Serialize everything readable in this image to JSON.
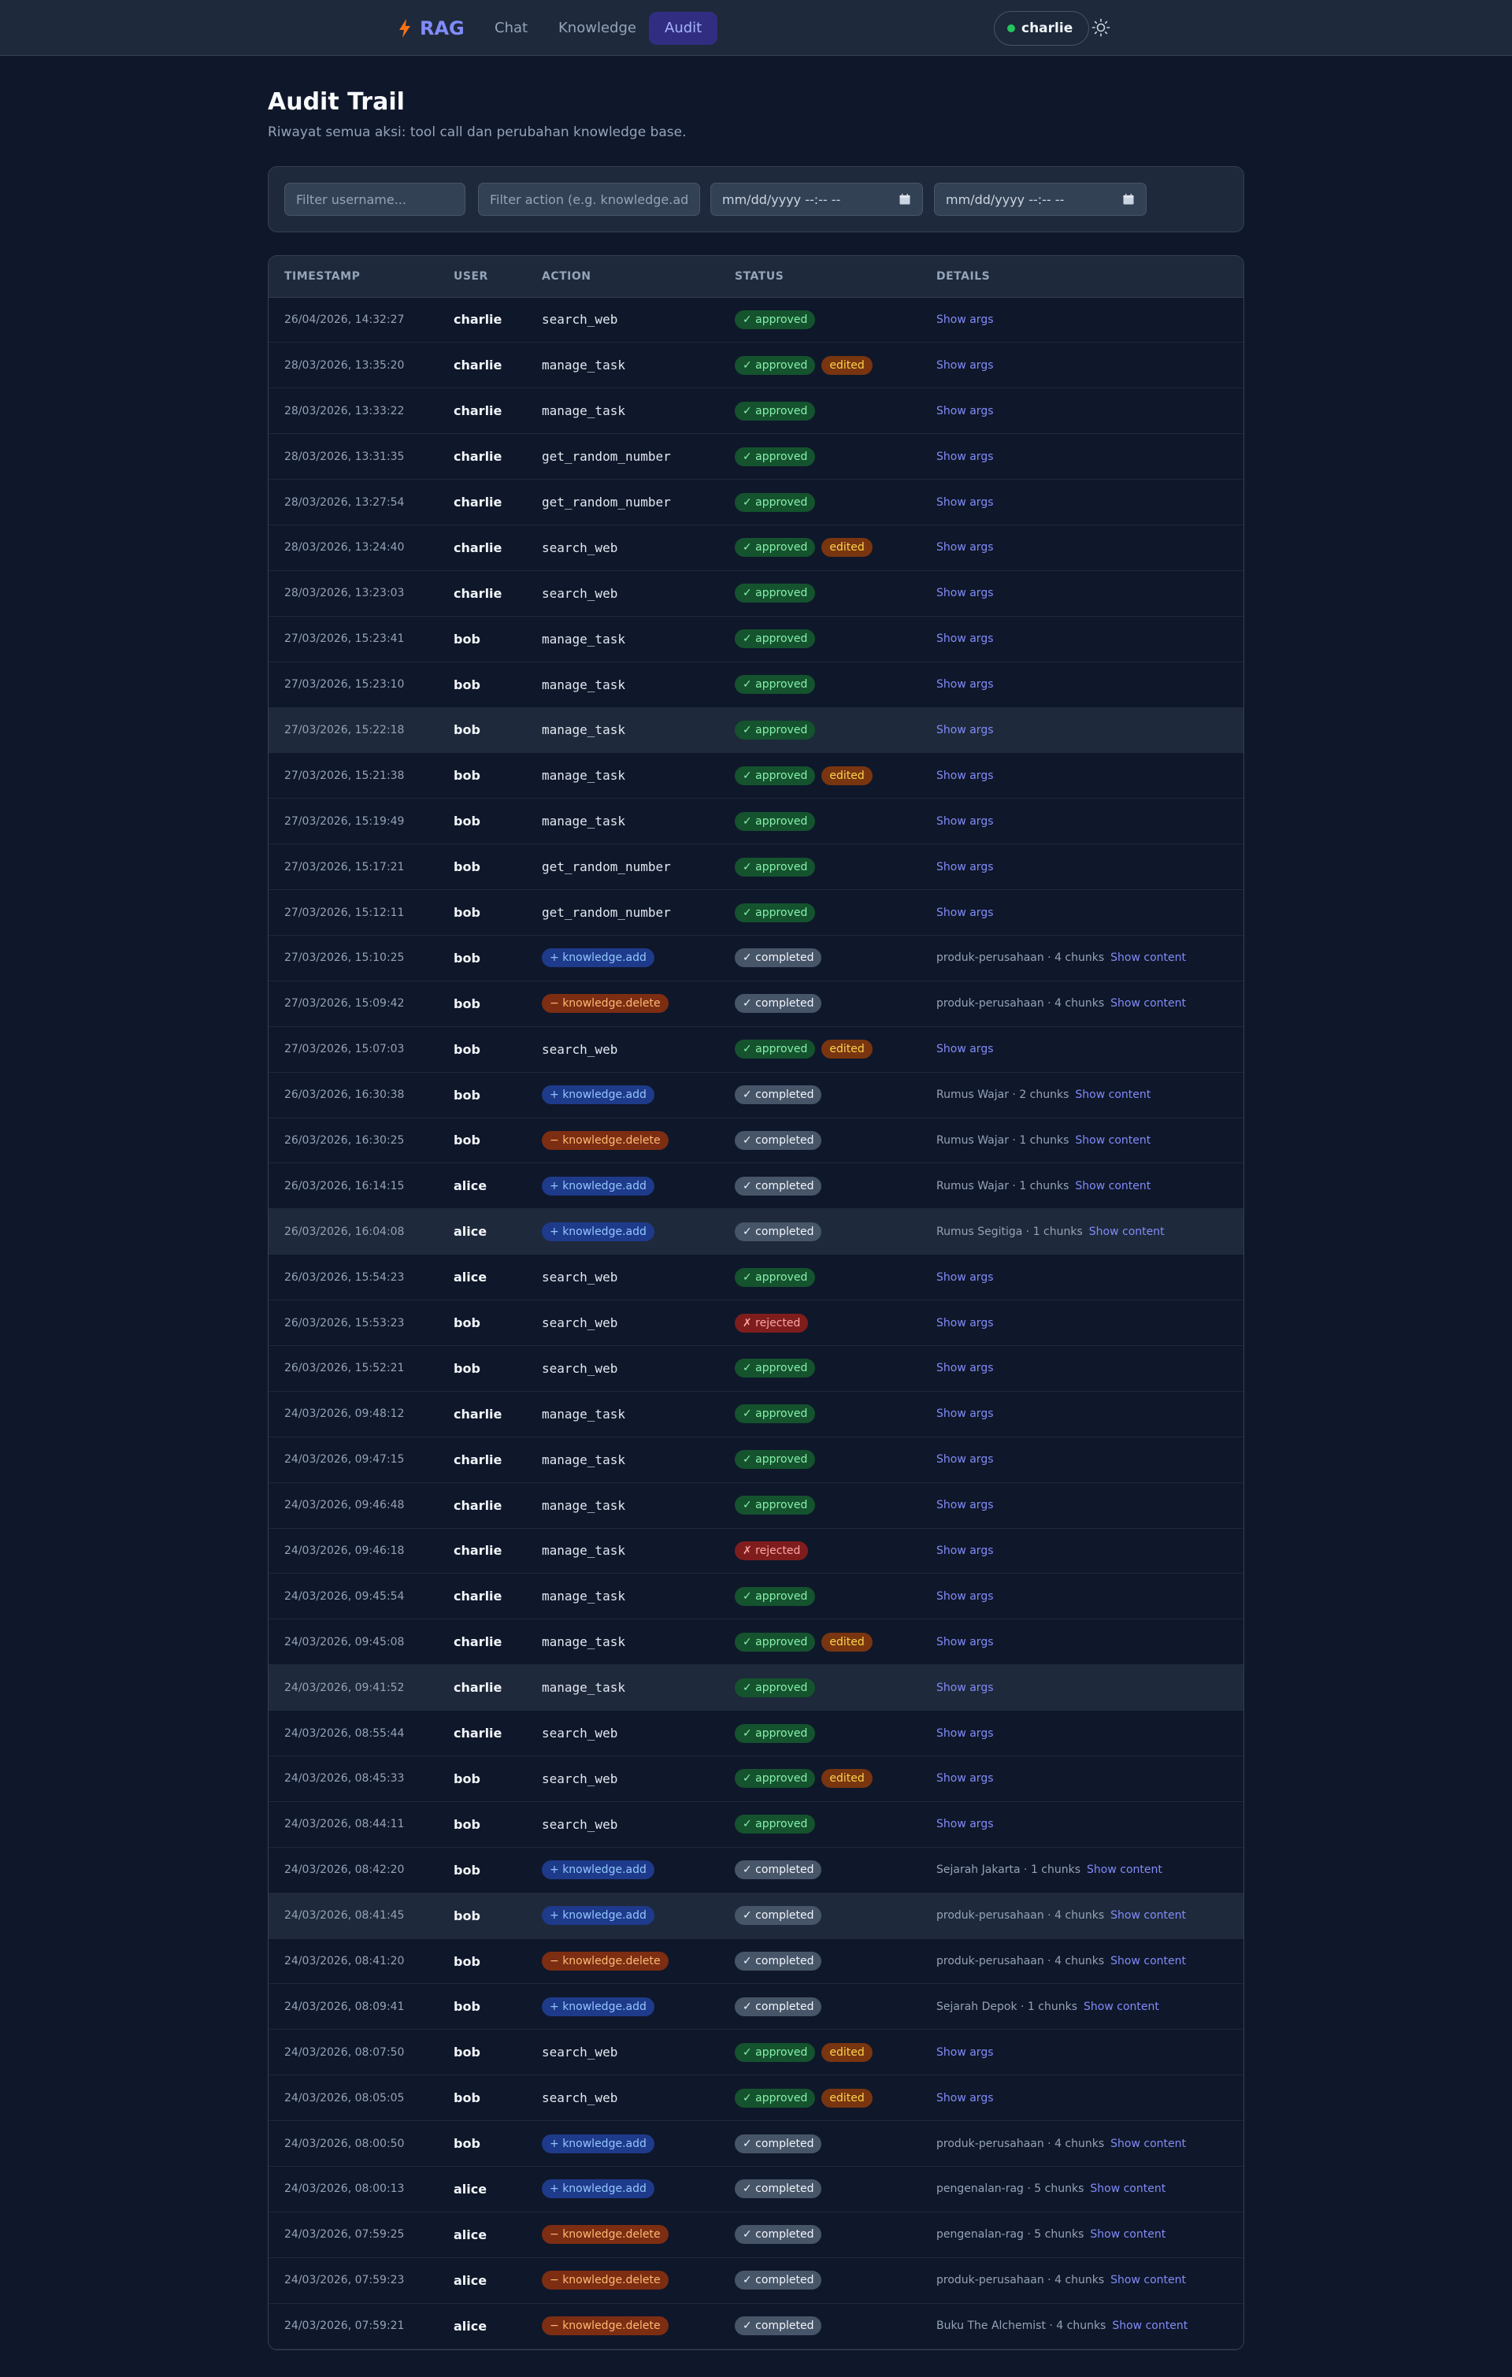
{
  "nav": {
    "brand": "RAG",
    "links": [
      "Chat",
      "Knowledge",
      "Audit"
    ],
    "active": "Audit",
    "user": "charlie",
    "user_status_color": "#22c55e",
    "theme_icon": "sun-icon"
  },
  "page": {
    "title": "Audit Trail",
    "subtitle": "Riwayat semua aksi: tool call dan perubahan knowledge base."
  },
  "filters": {
    "username_placeholder": "Filter username...",
    "action_placeholder": "Filter action (e.g. knowledge.add)",
    "date_from": "mm/dd/yyyy --:-- --",
    "date_to": "mm/dd/yyyy --:-- --"
  },
  "table": {
    "headers": [
      "TIMESTAMP",
      "USER",
      "ACTION",
      "STATUS",
      "DETAILS"
    ],
    "show_args": "Show args",
    "show_content": "Show content",
    "rows": [
      {
        "ts": "26/04/2026, 14:32:27",
        "user": "charlie",
        "action": "search_web",
        "status": "approved",
        "edited": false
      },
      {
        "ts": "28/03/2026, 13:35:20",
        "user": "charlie",
        "action": "manage_task",
        "status": "approved",
        "edited": true
      },
      {
        "ts": "28/03/2026, 13:33:22",
        "user": "charlie",
        "action": "manage_task",
        "status": "approved",
        "edited": false
      },
      {
        "ts": "28/03/2026, 13:31:35",
        "user": "charlie",
        "action": "get_random_number",
        "status": "approved",
        "edited": false
      },
      {
        "ts": "28/03/2026, 13:27:54",
        "user": "charlie",
        "action": "get_random_number",
        "status": "approved",
        "edited": false
      },
      {
        "ts": "28/03/2026, 13:24:40",
        "user": "charlie",
        "action": "search_web",
        "status": "approved",
        "edited": true
      },
      {
        "ts": "28/03/2026, 13:23:03",
        "user": "charlie",
        "action": "search_web",
        "status": "approved",
        "edited": false
      },
      {
        "ts": "27/03/2026, 15:23:41",
        "user": "bob",
        "action": "manage_task",
        "status": "approved",
        "edited": false
      },
      {
        "ts": "27/03/2026, 15:23:10",
        "user": "bob",
        "action": "manage_task",
        "status": "approved",
        "edited": false
      },
      {
        "ts": "27/03/2026, 15:22:18",
        "user": "bob",
        "action": "manage_task",
        "status": "approved",
        "edited": false
      },
      {
        "ts": "27/03/2026, 15:21:38",
        "user": "bob",
        "action": "manage_task",
        "status": "approved",
        "edited": true
      },
      {
        "ts": "27/03/2026, 15:19:49",
        "user": "bob",
        "action": "manage_task",
        "status": "approved",
        "edited": false
      },
      {
        "ts": "27/03/2026, 15:17:21",
        "user": "bob",
        "action": "get_random_number",
        "status": "approved",
        "edited": false
      },
      {
        "ts": "27/03/2026, 15:12:11",
        "user": "bob",
        "action": "get_random_number",
        "status": "approved",
        "edited": false
      },
      {
        "ts": "27/03/2026, 15:10:25",
        "user": "bob",
        "action": "knowledge.add",
        "status": "completed",
        "edited": false,
        "detail": "produk-perusahaan · 4 chunks"
      },
      {
        "ts": "27/03/2026, 15:09:42",
        "user": "bob",
        "action": "knowledge.delete",
        "status": "completed",
        "edited": false,
        "detail": "produk-perusahaan · 4 chunks"
      },
      {
        "ts": "27/03/2026, 15:07:03",
        "user": "bob",
        "action": "search_web",
        "status": "approved",
        "edited": true
      },
      {
        "ts": "26/03/2026, 16:30:38",
        "user": "bob",
        "action": "knowledge.add",
        "status": "completed",
        "edited": false,
        "detail": "Rumus Wajar · 2 chunks"
      },
      {
        "ts": "26/03/2026, 16:30:25",
        "user": "bob",
        "action": "knowledge.delete",
        "status": "completed",
        "edited": false,
        "detail": "Rumus Wajar · 1 chunks"
      },
      {
        "ts": "26/03/2026, 16:14:15",
        "user": "alice",
        "action": "knowledge.add",
        "status": "completed",
        "edited": false,
        "detail": "Rumus Wajar · 1 chunks"
      },
      {
        "ts": "26/03/2026, 16:04:08",
        "user": "alice",
        "action": "knowledge.add",
        "status": "completed",
        "edited": false,
        "detail": "Rumus Segitiga · 1 chunks"
      },
      {
        "ts": "26/03/2026, 15:54:23",
        "user": "alice",
        "action": "search_web",
        "status": "approved",
        "edited": false
      },
      {
        "ts": "26/03/2026, 15:53:23",
        "user": "bob",
        "action": "search_web",
        "status": "rejected",
        "edited": false
      },
      {
        "ts": "26/03/2026, 15:52:21",
        "user": "bob",
        "action": "search_web",
        "status": "approved",
        "edited": false
      },
      {
        "ts": "24/03/2026, 09:48:12",
        "user": "charlie",
        "action": "manage_task",
        "status": "approved",
        "edited": false
      },
      {
        "ts": "24/03/2026, 09:47:15",
        "user": "charlie",
        "action": "manage_task",
        "status": "approved",
        "edited": false
      },
      {
        "ts": "24/03/2026, 09:46:48",
        "user": "charlie",
        "action": "manage_task",
        "status": "approved",
        "edited": false
      },
      {
        "ts": "24/03/2026, 09:46:18",
        "user": "charlie",
        "action": "manage_task",
        "status": "rejected",
        "edited": false
      },
      {
        "ts": "24/03/2026, 09:45:54",
        "user": "charlie",
        "action": "manage_task",
        "status": "approved",
        "edited": false
      },
      {
        "ts": "24/03/2026, 09:45:08",
        "user": "charlie",
        "action": "manage_task",
        "status": "approved",
        "edited": true
      },
      {
        "ts": "24/03/2026, 09:41:52",
        "user": "charlie",
        "action": "manage_task",
        "status": "approved",
        "edited": false
      },
      {
        "ts": "24/03/2026, 08:55:44",
        "user": "charlie",
        "action": "search_web",
        "status": "approved",
        "edited": false
      },
      {
        "ts": "24/03/2026, 08:45:33",
        "user": "bob",
        "action": "search_web",
        "status": "approved",
        "edited": true
      },
      {
        "ts": "24/03/2026, 08:44:11",
        "user": "bob",
        "action": "search_web",
        "status": "approved",
        "edited": false
      },
      {
        "ts": "24/03/2026, 08:42:20",
        "user": "bob",
        "action": "knowledge.add",
        "status": "completed",
        "edited": false,
        "detail": "Sejarah Jakarta · 1 chunks"
      },
      {
        "ts": "24/03/2026, 08:41:45",
        "user": "bob",
        "action": "knowledge.add",
        "status": "completed",
        "edited": false,
        "detail": "produk-perusahaan · 4 chunks"
      },
      {
        "ts": "24/03/2026, 08:41:20",
        "user": "bob",
        "action": "knowledge.delete",
        "status": "completed",
        "edited": false,
        "detail": "produk-perusahaan · 4 chunks"
      },
      {
        "ts": "24/03/2026, 08:09:41",
        "user": "bob",
        "action": "knowledge.add",
        "status": "completed",
        "edited": false,
        "detail": "Sejarah Depok · 1 chunks"
      },
      {
        "ts": "24/03/2026, 08:07:50",
        "user": "bob",
        "action": "search_web",
        "status": "approved",
        "edited": true
      },
      {
        "ts": "24/03/2026, 08:05:05",
        "user": "bob",
        "action": "search_web",
        "status": "approved",
        "edited": true
      },
      {
        "ts": "24/03/2026, 08:00:50",
        "user": "bob",
        "action": "knowledge.add",
        "status": "completed",
        "edited": false,
        "detail": "produk-perusahaan · 4 chunks"
      },
      {
        "ts": "24/03/2026, 08:00:13",
        "user": "alice",
        "action": "knowledge.add",
        "status": "completed",
        "edited": false,
        "detail": "pengenalan-rag · 5 chunks"
      },
      {
        "ts": "24/03/2026, 07:59:25",
        "user": "alice",
        "action": "knowledge.delete",
        "status": "completed",
        "edited": false,
        "detail": "pengenalan-rag · 5 chunks"
      },
      {
        "ts": "24/03/2026, 07:59:23",
        "user": "alice",
        "action": "knowledge.delete",
        "status": "completed",
        "edited": false,
        "detail": "produk-perusahaan · 4 chunks"
      },
      {
        "ts": "24/03/2026, 07:59:21",
        "user": "alice",
        "action": "knowledge.delete",
        "status": "completed",
        "edited": false,
        "detail": "Buku The Alchemist · 4 chunks"
      }
    ],
    "highlighted_rows": [
      9,
      20,
      30,
      35
    ]
  },
  "status_labels": {
    "approved": "✓ approved",
    "rejected": "✗ rejected",
    "completed": "✓ completed",
    "edited": "edited",
    "add_prefix": "+ ",
    "delete_prefix": "− "
  },
  "colors": {
    "accent": "#818cf8",
    "approved": "#86efac",
    "rejected": "#fca5a5",
    "edited": "#fcd34d"
  }
}
